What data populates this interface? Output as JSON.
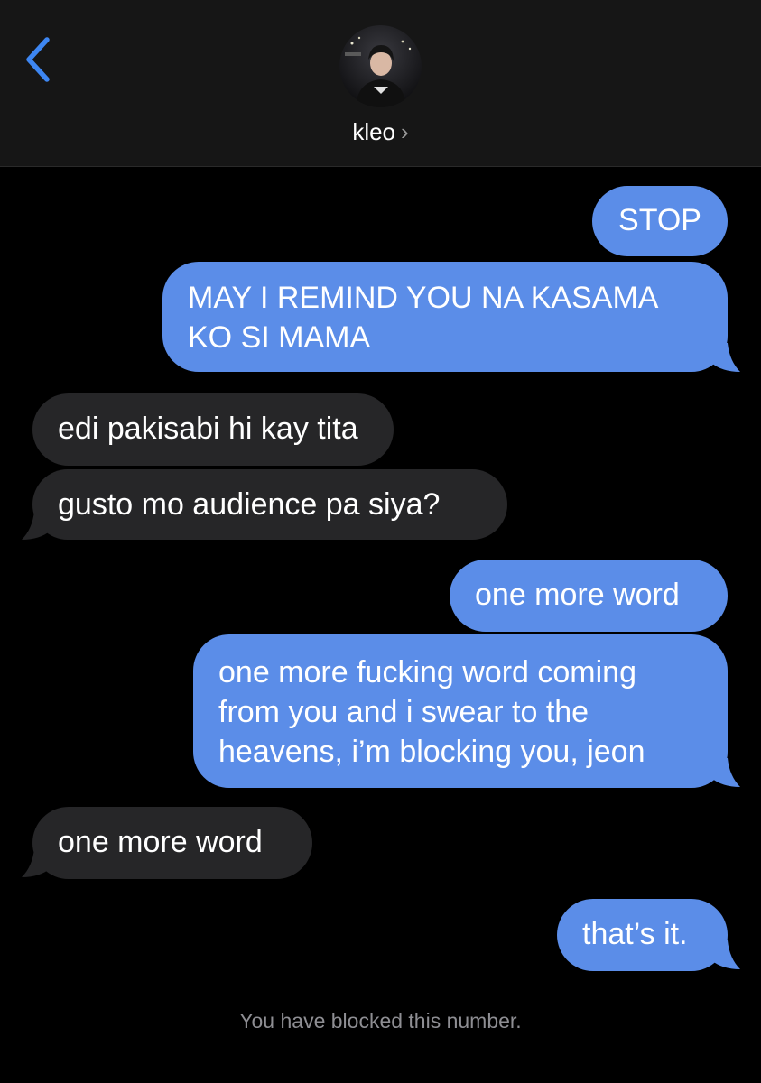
{
  "header": {
    "contact_name": "kleo",
    "chevron": "›"
  },
  "messages": [
    {
      "dir": "sent",
      "text": "STOP"
    },
    {
      "dir": "sent",
      "text": "MAY I REMIND YOU NA KASAMA KO SI MAMA"
    },
    {
      "dir": "received",
      "text": "edi pakisabi hi kay tita"
    },
    {
      "dir": "received",
      "text": "gusto mo audience pa siya?"
    },
    {
      "dir": "sent",
      "text": "one more word"
    },
    {
      "dir": "sent",
      "text": "one more fucking word coming from you and i swear to the heavens, i’m blocking you, jeon"
    },
    {
      "dir": "received",
      "text": "one more word"
    },
    {
      "dir": "sent",
      "text": "that’s it."
    }
  ],
  "status_note": "You have blocked this number.",
  "colors": {
    "sent_bubble": "#5b8de8",
    "received_bubble": "#262628",
    "accent": "#3d86f2",
    "header_bg": "#161616"
  }
}
